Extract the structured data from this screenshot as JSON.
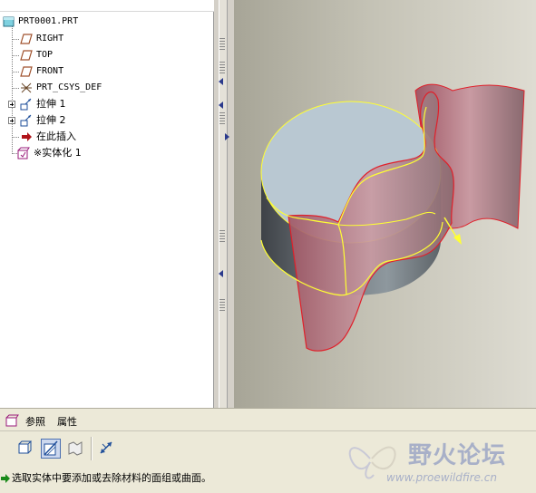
{
  "model_tree": {
    "root": "PRT0001.PRT",
    "items": [
      {
        "label": "RIGHT",
        "icon": "datum-plane-icon"
      },
      {
        "label": "TOP",
        "icon": "datum-plane-icon"
      },
      {
        "label": "FRONT",
        "icon": "datum-plane-icon"
      },
      {
        "label": "PRT_CSYS_DEF",
        "icon": "coordinate-system-icon"
      },
      {
        "label": "拉伸 1",
        "icon": "extrude-icon"
      },
      {
        "label": "拉伸 2",
        "icon": "extrude-icon"
      },
      {
        "label": "在此插入",
        "icon": "insert-here-arrow-icon"
      },
      {
        "label": "※实体化 1",
        "icon": "solidify-icon"
      }
    ]
  },
  "dashboard": {
    "tabs": [
      "参照",
      "属性"
    ],
    "tools": [
      "solid-icon",
      "remove-material-icon",
      "surface-patch-icon",
      "flip-direction-icon"
    ],
    "message": "选取实体中要添加或去除材料的面组或曲面。"
  },
  "watermark": {
    "title": "野火论坛",
    "url": "www.proewildfire.cn"
  },
  "colors": {
    "edge_highlight": "#ffff33",
    "surface_edge": "#e0202a",
    "surface_fill": "#c88e98"
  }
}
